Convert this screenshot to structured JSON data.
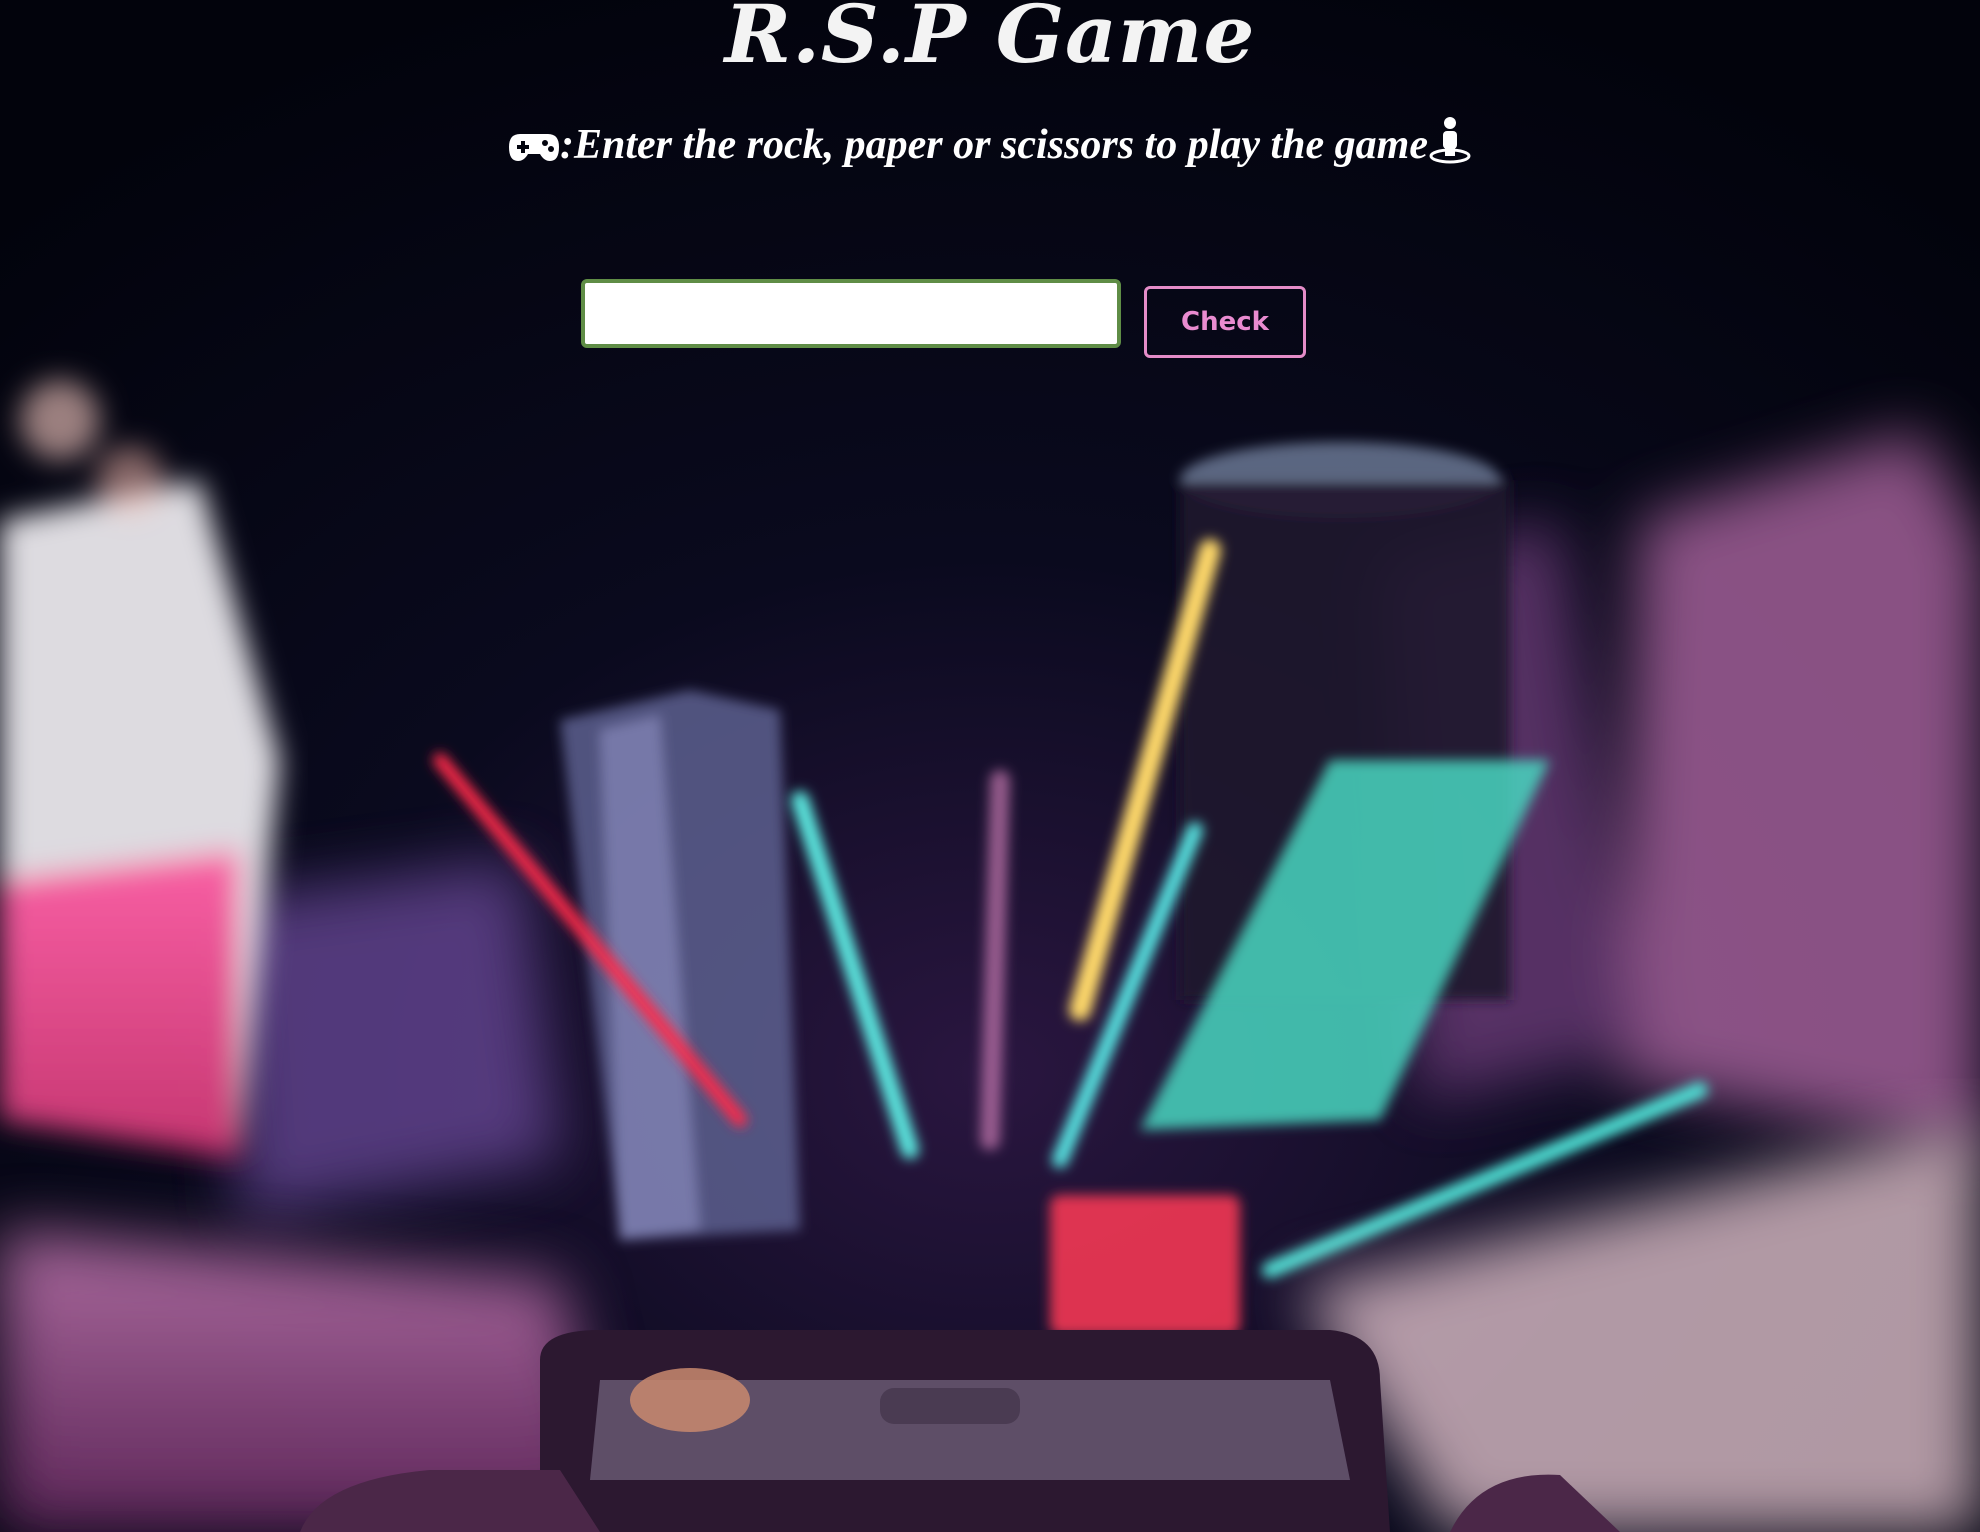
{
  "page": {
    "title": "R.S.P Game",
    "instruction": ":Enter the rock, paper or scissors to play the game",
    "leading_icon": "gamepad-icon",
    "trailing_icon": "person-on-pad-icon"
  },
  "form": {
    "input_value": "",
    "input_placeholder": "",
    "check_label": "Check"
  },
  "colors": {
    "background": "#03040e",
    "title_text": "#f3f3f3",
    "input_border": "#5f8d46",
    "button_accent": "#e98bd0"
  },
  "background_image": {
    "subject": "night city street with neon light trails seen from a convertible car"
  }
}
